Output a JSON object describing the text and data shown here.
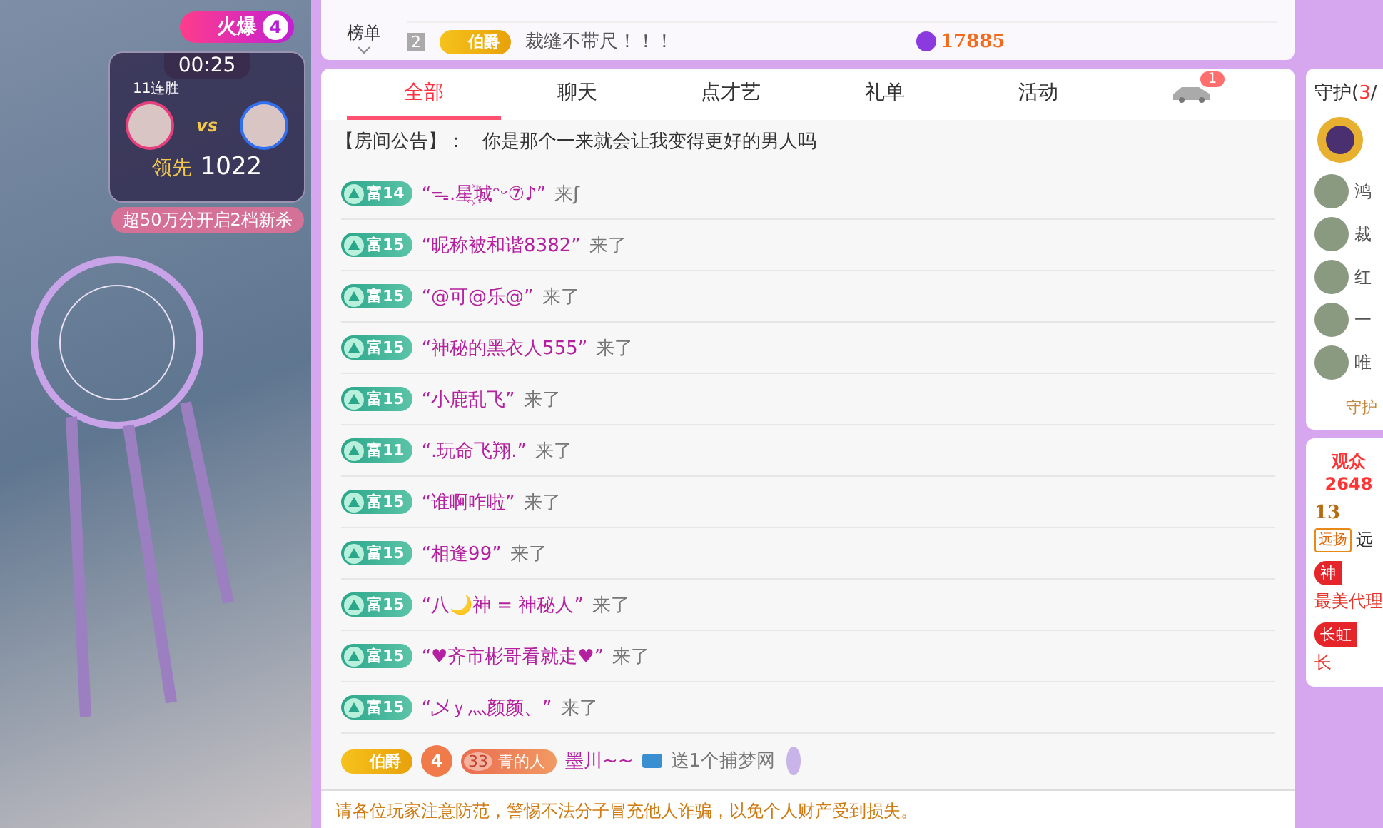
{
  "stream": {
    "heat_label": "火爆",
    "heat_count": "4",
    "pk": {
      "timer": "00:25",
      "streak": "11连胜",
      "vs": "vs",
      "lead_label": "领先",
      "lead_score": "1022"
    },
    "banner": "超50万分开启2档新杀"
  },
  "rank": {
    "title": "榜单",
    "rows": [
      {
        "rank": "2",
        "badge": "伯爵",
        "name": "裁缝不带尺！！！",
        "score": "17885"
      }
    ]
  },
  "tabs": [
    {
      "label": "全部",
      "selected": true
    },
    {
      "label": "聊天",
      "selected": false
    },
    {
      "label": "点才艺",
      "selected": false
    },
    {
      "label": "礼单",
      "selected": false
    },
    {
      "label": "活动",
      "selected": false
    },
    {
      "kind": "car",
      "badge": "1",
      "selected": false
    }
  ],
  "announcement": {
    "label": "【房间公告】：",
    "text": "你是那个一来就会让我变得更好的男人吗"
  },
  "messages": [
    {
      "kind": "enter",
      "badge": "富14",
      "name": "“ᯓ.星꙰城ᵔᵕ⑦♪”",
      "suffix": "来ʃ"
    },
    {
      "kind": "enter",
      "badge": "富15",
      "name": "“昵称被和谐8382”",
      "suffix": "来了"
    },
    {
      "kind": "enter",
      "badge": "富15",
      "name": "“@可@乐@”",
      "suffix": "来了"
    },
    {
      "kind": "enter",
      "badge": "富15",
      "name": "“神秘的黑衣人555”",
      "suffix": "来了"
    },
    {
      "kind": "enter",
      "badge": "富15",
      "name": "“小鹿乱飞”",
      "suffix": "来了"
    },
    {
      "kind": "enter",
      "badge": "富11",
      "name": "“.玩命飞翔.”",
      "suffix": "来了"
    },
    {
      "kind": "enter",
      "badge": "富15",
      "name": "“谁啊咋啦”",
      "suffix": "来了"
    },
    {
      "kind": "enter",
      "badge": "富15",
      "name": "“相逢99”",
      "suffix": "来了"
    },
    {
      "kind": "enter",
      "badge": "富15",
      "name": "“八🌙神 = 神秘人”",
      "suffix": "来了"
    },
    {
      "kind": "enter",
      "badge": "富15",
      "name": "“♥齐市彬哥看就走♥”",
      "suffix": "来了"
    },
    {
      "kind": "enter",
      "badge": "富15",
      "name": "“乄ｙ灬颜颜、”",
      "suffix": "来了"
    },
    {
      "kind": "gift",
      "badge": "伯爵",
      "medal": "4",
      "fan_level": "33",
      "fan_name": "青的人",
      "name": "墨川~~",
      "text": "送1个捕梦网"
    }
  ],
  "notice": "请各位玩家注意防范，警惕不法分子冒充他人诈骗，以免个人财产受到损失。",
  "guard": {
    "title": "守护",
    "open": "(",
    "count": "3",
    "sep": "/",
    "members": [
      "鸿",
      "裁",
      "红",
      "一",
      "唯"
    ],
    "link": "守护"
  },
  "audience": {
    "label": "观众",
    "count": "2648"
  },
  "viewers": [
    {
      "level": "13",
      "tag": "远扬",
      "name": "远"
    },
    {
      "tag": "神",
      "name": "最美代理"
    },
    {
      "tag": "长虹",
      "name": "长"
    }
  ]
}
